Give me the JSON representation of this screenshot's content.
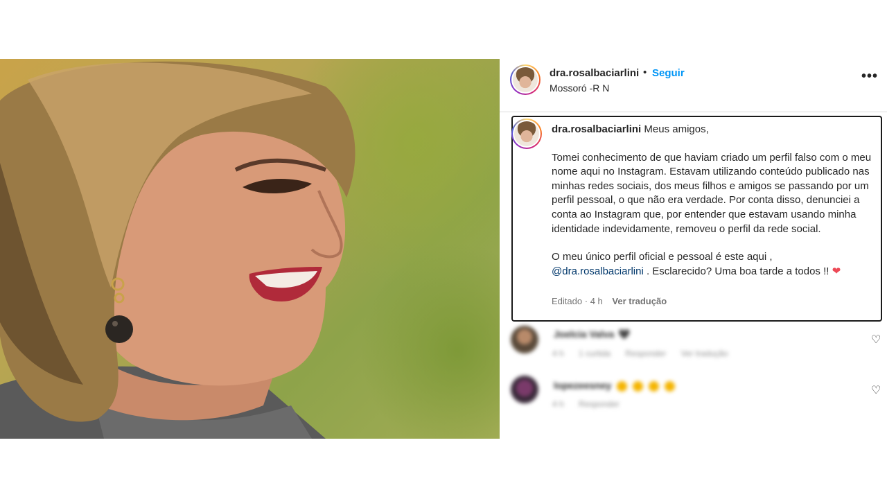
{
  "post": {
    "username": "dra.rosalbaciarlini",
    "separator": "•",
    "follow_label": "Seguir",
    "location": "Mossoró -R N",
    "more_label": "•••"
  },
  "caption": {
    "username": "dra.rosalbaciarlini",
    "greeting": "Meus amigos,",
    "paragraph1": "Tomei conhecimento de que haviam criado um perfil falso com o meu nome aqui no Instagram. Estavam utilizando conteúdo publicado nas minhas redes sociais, dos meus filhos e amigos se passando por um perfil pessoal, o que não era verdade. Por conta disso, denunciei a conta ao Instagram que, por entender que estavam usando minha identidade indevidamente, removeu o perfil da rede social.",
    "paragraph2_start": "O meu único perfil oficial e pessoal é este aqui ,",
    "mention": "@dra.rosalbaciarlini",
    "paragraph2_end": ". Esclarecido? Uma boa tarde a todos !!",
    "heart_emoji": "❤",
    "edited_label": "Editado",
    "time": "4 h",
    "time_separator": "·",
    "translate_label": "Ver tradução"
  },
  "comments": [
    {
      "username": "Joelcia Valva",
      "text": "🖤",
      "time": "4 h",
      "likes": "1 curtida",
      "reply_label": "Responder",
      "translate_label": "Ver tradução",
      "like_icon": "heart-outline-icon"
    },
    {
      "username": "lopezeesney",
      "text": "",
      "time": "4 h",
      "reply_label": "Responder",
      "like_icon": "heart-outline-icon"
    }
  ],
  "colors": {
    "accent": "#0095f6",
    "mention": "#00376b",
    "text": "#262626",
    "secondary": "#737373",
    "heart": "#ed4956"
  }
}
